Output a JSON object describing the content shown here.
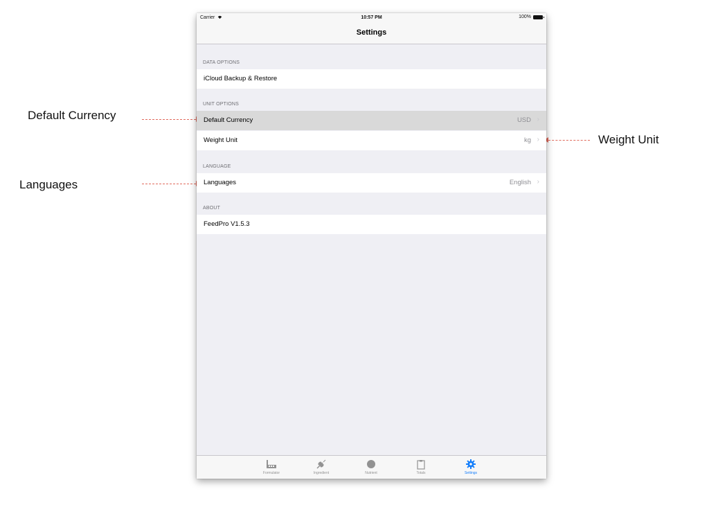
{
  "status_bar": {
    "carrier": "Carrier",
    "time": "10:57 PM",
    "battery": "100%"
  },
  "nav": {
    "title": "Settings"
  },
  "sections": [
    {
      "header": "DATA OPTIONS",
      "rows": [
        {
          "label": "iCloud Backup & Restore"
        }
      ]
    },
    {
      "header": "UNIT OPTIONS",
      "rows": [
        {
          "label": "Default Currency",
          "value": "USD"
        },
        {
          "label": "Weight Unit",
          "value": "kg"
        }
      ]
    },
    {
      "header": "LANGUAGE",
      "rows": [
        {
          "label": "Languages",
          "value": "English"
        }
      ]
    },
    {
      "header": "ABOUT",
      "rows": [
        {
          "label": "FeedPro V1.5.3"
        }
      ]
    }
  ],
  "tabs": [
    {
      "label": "Formulator",
      "icon": "factory-icon",
      "active": false
    },
    {
      "label": "Ingredient",
      "icon": "wheat-icon",
      "active": false
    },
    {
      "label": "Nutrient",
      "icon": "circle-icon",
      "active": false
    },
    {
      "label": "Totals",
      "icon": "clipboard-icon",
      "active": false
    },
    {
      "label": "Settings",
      "icon": "gear-icon",
      "active": true
    }
  ],
  "annotations": {
    "default_currency": "Default Currency",
    "weight_unit": "Weight Unit",
    "languages": "Languages"
  },
  "colors": {
    "accent": "#147efb",
    "arrow": "#e06a5c",
    "highlight": "#d9d9d9"
  }
}
